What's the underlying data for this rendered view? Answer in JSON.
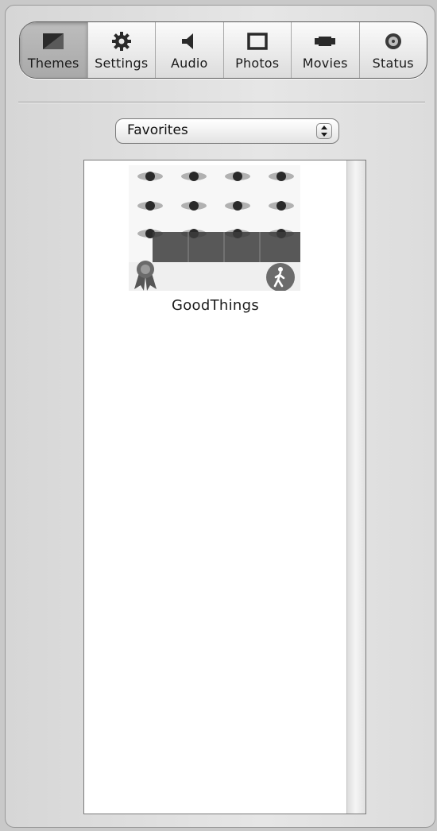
{
  "toolbar": {
    "items": [
      {
        "label": "Themes",
        "icon": "themes-icon",
        "active": true
      },
      {
        "label": "Settings",
        "icon": "gear-icon",
        "active": false
      },
      {
        "label": "Audio",
        "icon": "speaker-icon",
        "active": false
      },
      {
        "label": "Photos",
        "icon": "photo-frame-icon",
        "active": false
      },
      {
        "label": "Movies",
        "icon": "movie-camera-icon",
        "active": false
      },
      {
        "label": "Status",
        "icon": "disc-icon",
        "active": false
      }
    ]
  },
  "filter": {
    "selected": "Favorites"
  },
  "themes": {
    "items": [
      {
        "name": "GoodThings",
        "icon_left": "award-ribbon-icon",
        "icon_right": "walking-person-icon"
      }
    ]
  }
}
